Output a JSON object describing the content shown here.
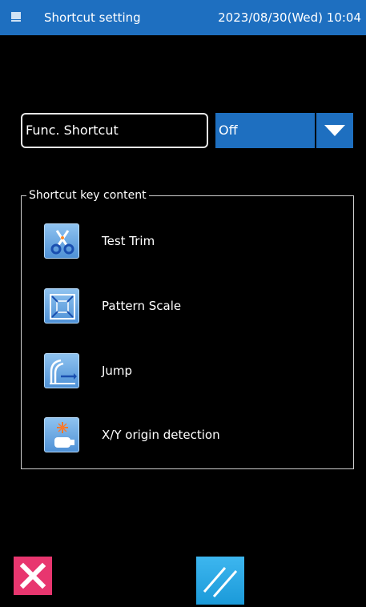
{
  "header": {
    "title": "Shortcut setting",
    "datetime": "2023/08/30(Wed) 10:04",
    "icon": "device-icon"
  },
  "shortcut": {
    "label": "Func. Shortcut",
    "selected_value": "Off"
  },
  "content_group": {
    "legend": "Shortcut key content",
    "items": [
      {
        "label": "Test Trim",
        "icon": "scissors-icon"
      },
      {
        "label": "Pattern Scale",
        "icon": "pattern-scale-icon"
      },
      {
        "label": "Jump",
        "icon": "jump-icon"
      },
      {
        "label": "X/Y origin detection",
        "icon": "origin-detection-icon"
      }
    ]
  },
  "footer": {
    "cancel_icon": "close-icon",
    "confirm_icon": "confirm-slash-icon"
  },
  "colors": {
    "header_bg": "#1e6fc0",
    "select_bg": "#1e6fc0",
    "cancel_bg": "#e8366f",
    "confirm_bg": "#1b9ad9",
    "background": "#000000"
  }
}
